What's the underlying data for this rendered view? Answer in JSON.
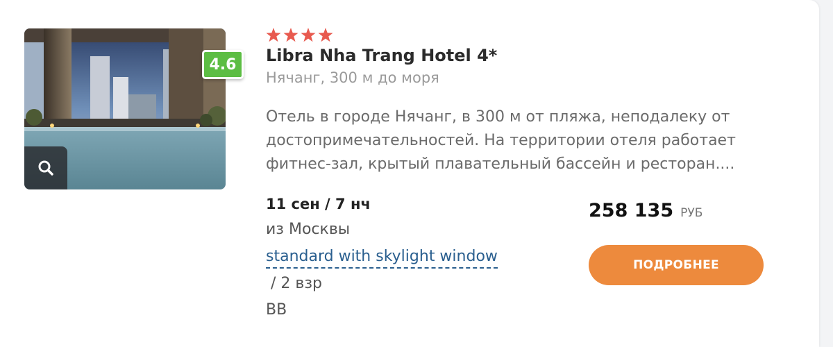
{
  "hotel": {
    "stars": 4,
    "star_color": "#e85a4f",
    "rating": "4.6",
    "rating_color": "#5cbd43",
    "name": "Libra Nha Trang Hotel 4*",
    "location": "Нячанг, 300 м до моря",
    "description_lines": [
      "Отель в городе Нячанг, в 300 м от пляжа, неподалеку от",
      "достопримечательностей. На территории отеля работает",
      "фитнес-зал, крытый плавательный бассейн и ресторан...."
    ],
    "photo_icon": "hotel-pool-photo"
  },
  "tour": {
    "dates": "11 сен / 7 нч",
    "departure": "из Москвы",
    "room": "standard with skylight window",
    "guests": " / 2 взр",
    "meal": "BB"
  },
  "price": {
    "amount": "258 135",
    "currency": "РУБ"
  },
  "actions": {
    "details_label": "ПОДРОБНЕЕ",
    "details_color": "#ed8a3d",
    "zoom_icon": "search-icon"
  }
}
